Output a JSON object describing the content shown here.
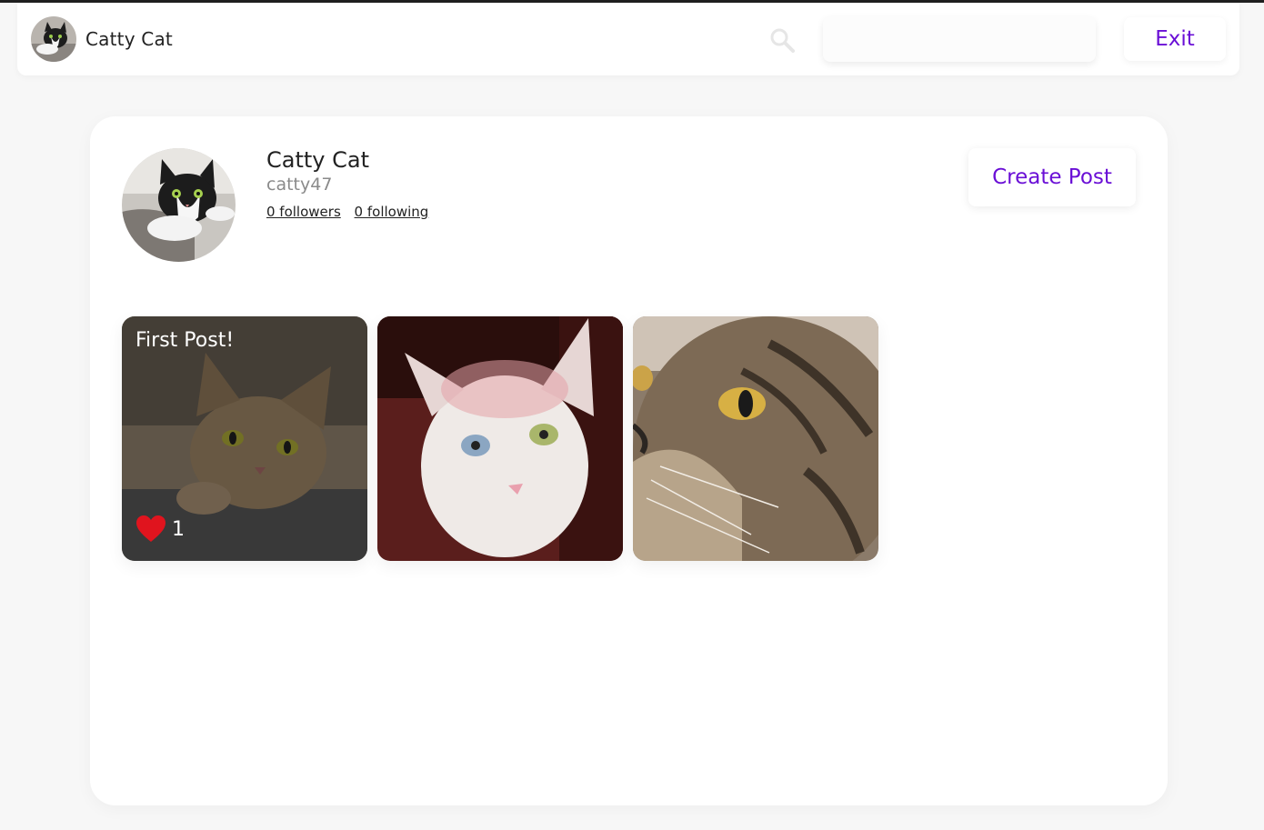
{
  "header": {
    "user_name": "Catty Cat",
    "search_value": "",
    "exit_label": "Exit"
  },
  "profile": {
    "name": "Catty Cat",
    "handle": "catty47",
    "followers_label": "0 followers",
    "following_label": "0 following",
    "create_post_label": "Create Post"
  },
  "posts": [
    {
      "title": "First Post!",
      "likes": "1"
    },
    {
      "title": "",
      "likes": ""
    },
    {
      "title": "",
      "likes": ""
    }
  ],
  "colors": {
    "accent": "#6a0fd6",
    "like": "#e0141e"
  }
}
